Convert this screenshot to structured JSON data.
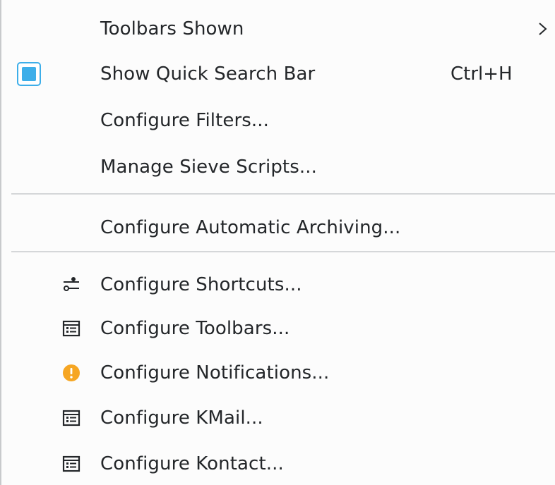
{
  "menu": {
    "items": [
      {
        "label": "Toolbars Shown",
        "has_submenu": true
      },
      {
        "label": "Show Quick Search Bar",
        "shortcut": "Ctrl+H",
        "checked": true
      },
      {
        "label": "Configure Filters..."
      },
      {
        "label": "Manage Sieve Scripts..."
      },
      {
        "label": "Configure Automatic Archiving..."
      },
      {
        "label": "Configure Shortcuts...",
        "icon": "shortcuts-icon"
      },
      {
        "label": "Configure Toolbars...",
        "icon": "toolbars-icon"
      },
      {
        "label": "Configure Notifications...",
        "icon": "notifications-icon"
      },
      {
        "label": "Configure KMail...",
        "icon": "kmail-config-icon"
      },
      {
        "label": "Configure Kontact...",
        "icon": "kontact-config-icon"
      }
    ]
  },
  "colors": {
    "accent": "#3daee9",
    "warning": "#f6a623",
    "text": "#232629",
    "separator": "#d5d7d9"
  }
}
